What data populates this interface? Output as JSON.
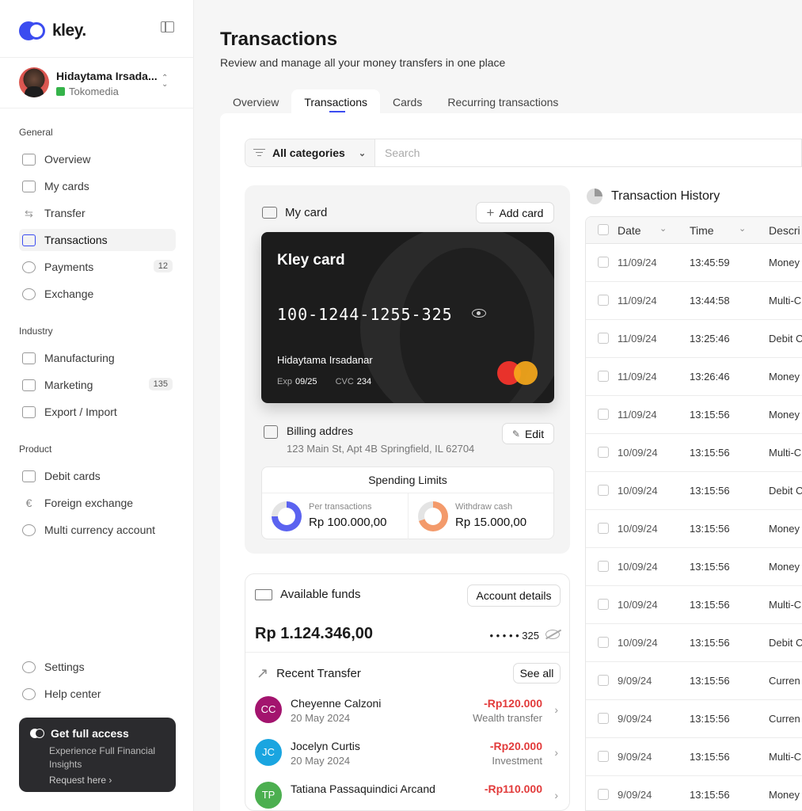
{
  "app": {
    "name": "kley."
  },
  "user": {
    "name": "Hidaytama Irsada...",
    "org": "Tokomedia"
  },
  "nav": {
    "general": {
      "title": "General",
      "items": [
        {
          "label": "Overview"
        },
        {
          "label": "My cards"
        },
        {
          "label": "Transfer"
        },
        {
          "label": "Transactions"
        },
        {
          "label": "Payments",
          "badge": "12"
        },
        {
          "label": "Exchange"
        }
      ]
    },
    "industry": {
      "title": "Industry",
      "items": [
        {
          "label": "Manufacturing"
        },
        {
          "label": "Marketing",
          "badge": "135"
        },
        {
          "label": "Export / Import"
        }
      ]
    },
    "product": {
      "title": "Product",
      "items": [
        {
          "label": "Debit cards"
        },
        {
          "label": "Foreign exchange"
        },
        {
          "label": "Multi currency account"
        }
      ]
    },
    "footer": [
      {
        "label": "Settings"
      },
      {
        "label": "Help center"
      }
    ]
  },
  "promo": {
    "title": "Get full access",
    "text": "Experience Full Financial Insights",
    "link": "Request here"
  },
  "page": {
    "title": "Transactions",
    "subtitle": "Review and manage all your money transfers in one place"
  },
  "tabs": [
    {
      "label": "Overview"
    },
    {
      "label": "Transactions"
    },
    {
      "label": "Cards"
    },
    {
      "label": "Recurring transactions"
    }
  ],
  "filter": {
    "category": "All categories",
    "search_placeholder": "Search"
  },
  "my_card": {
    "title": "My card",
    "add_label": "Add card",
    "card_title": "Kley card",
    "number": "100-1244-1255-325",
    "holder": "Hidaytama Irsadanar",
    "exp_label": "Exp",
    "exp": "09/25",
    "cvc_label": "CVC",
    "cvc": "234",
    "billing_title": "Billing addres",
    "billing_address": "123 Main St, Apt 4B Springfield, IL 62704",
    "edit_label": "Edit",
    "limits_title": "Spending Limits",
    "limits": [
      {
        "label": "Per transactions",
        "value": "Rp 100.000,00",
        "fraction": 0.75
      },
      {
        "label": "Withdraw cash",
        "value": "Rp 15.000,00",
        "fraction": 0.7
      }
    ]
  },
  "funds": {
    "title": "Available funds",
    "details_label": "Account details",
    "amount": "Rp 1.124.346,00",
    "masked": "• • • • • 325",
    "recent_title": "Recent Transfer",
    "see_all": "See all",
    "transfers": [
      {
        "initials": "CC",
        "name": "Cheyenne Calzoni",
        "date": "20 May 2024",
        "amount": "-Rp120.000",
        "type": "Wealth transfer",
        "color": "#a3146e"
      },
      {
        "initials": "JC",
        "name": "Jocelyn Curtis",
        "date": "20 May 2024",
        "amount": "-Rp20.000",
        "type": "Investment",
        "color": "#1aa5e0"
      },
      {
        "initials": "TP",
        "name": "Tatiana Passaquindici Arcand",
        "date": "",
        "amount": "-Rp110.000",
        "type": "",
        "color": "#4caf50"
      }
    ]
  },
  "history": {
    "title": "Transaction History",
    "columns": [
      "Date",
      "Time",
      "Descri"
    ],
    "rows": [
      {
        "date": "11/09/24",
        "time": "13:45:59",
        "desc": "Money"
      },
      {
        "date": "11/09/24",
        "time": "13:44:58",
        "desc": "Multi-C"
      },
      {
        "date": "11/09/24",
        "time": "13:25:46",
        "desc": "Debit C"
      },
      {
        "date": "11/09/24",
        "time": "13:26:46",
        "desc": "Money"
      },
      {
        "date": "11/09/24",
        "time": "13:15:56",
        "desc": "Money"
      },
      {
        "date": "10/09/24",
        "time": "13:15:56",
        "desc": "Multi-C"
      },
      {
        "date": "10/09/24",
        "time": "13:15:56",
        "desc": "Debit C"
      },
      {
        "date": "10/09/24",
        "time": "13:15:56",
        "desc": "Money"
      },
      {
        "date": "10/09/24",
        "time": "13:15:56",
        "desc": "Money"
      },
      {
        "date": "10/09/24",
        "time": "13:15:56",
        "desc": "Multi-C"
      },
      {
        "date": "10/09/24",
        "time": "13:15:56",
        "desc": "Debit C"
      },
      {
        "date": "9/09/24",
        "time": "13:15:56",
        "desc": "Curren"
      },
      {
        "date": "9/09/24",
        "time": "13:15:56",
        "desc": "Curren"
      },
      {
        "date": "9/09/24",
        "time": "13:15:56",
        "desc": "Multi-C"
      },
      {
        "date": "9/09/24",
        "time": "13:15:56",
        "desc": "Money"
      }
    ]
  },
  "colors": {
    "accent": "#3b4cf0",
    "negative": "#e23b3b",
    "donut_blue": "#5b63f0",
    "donut_orange": "#f39a6b"
  }
}
